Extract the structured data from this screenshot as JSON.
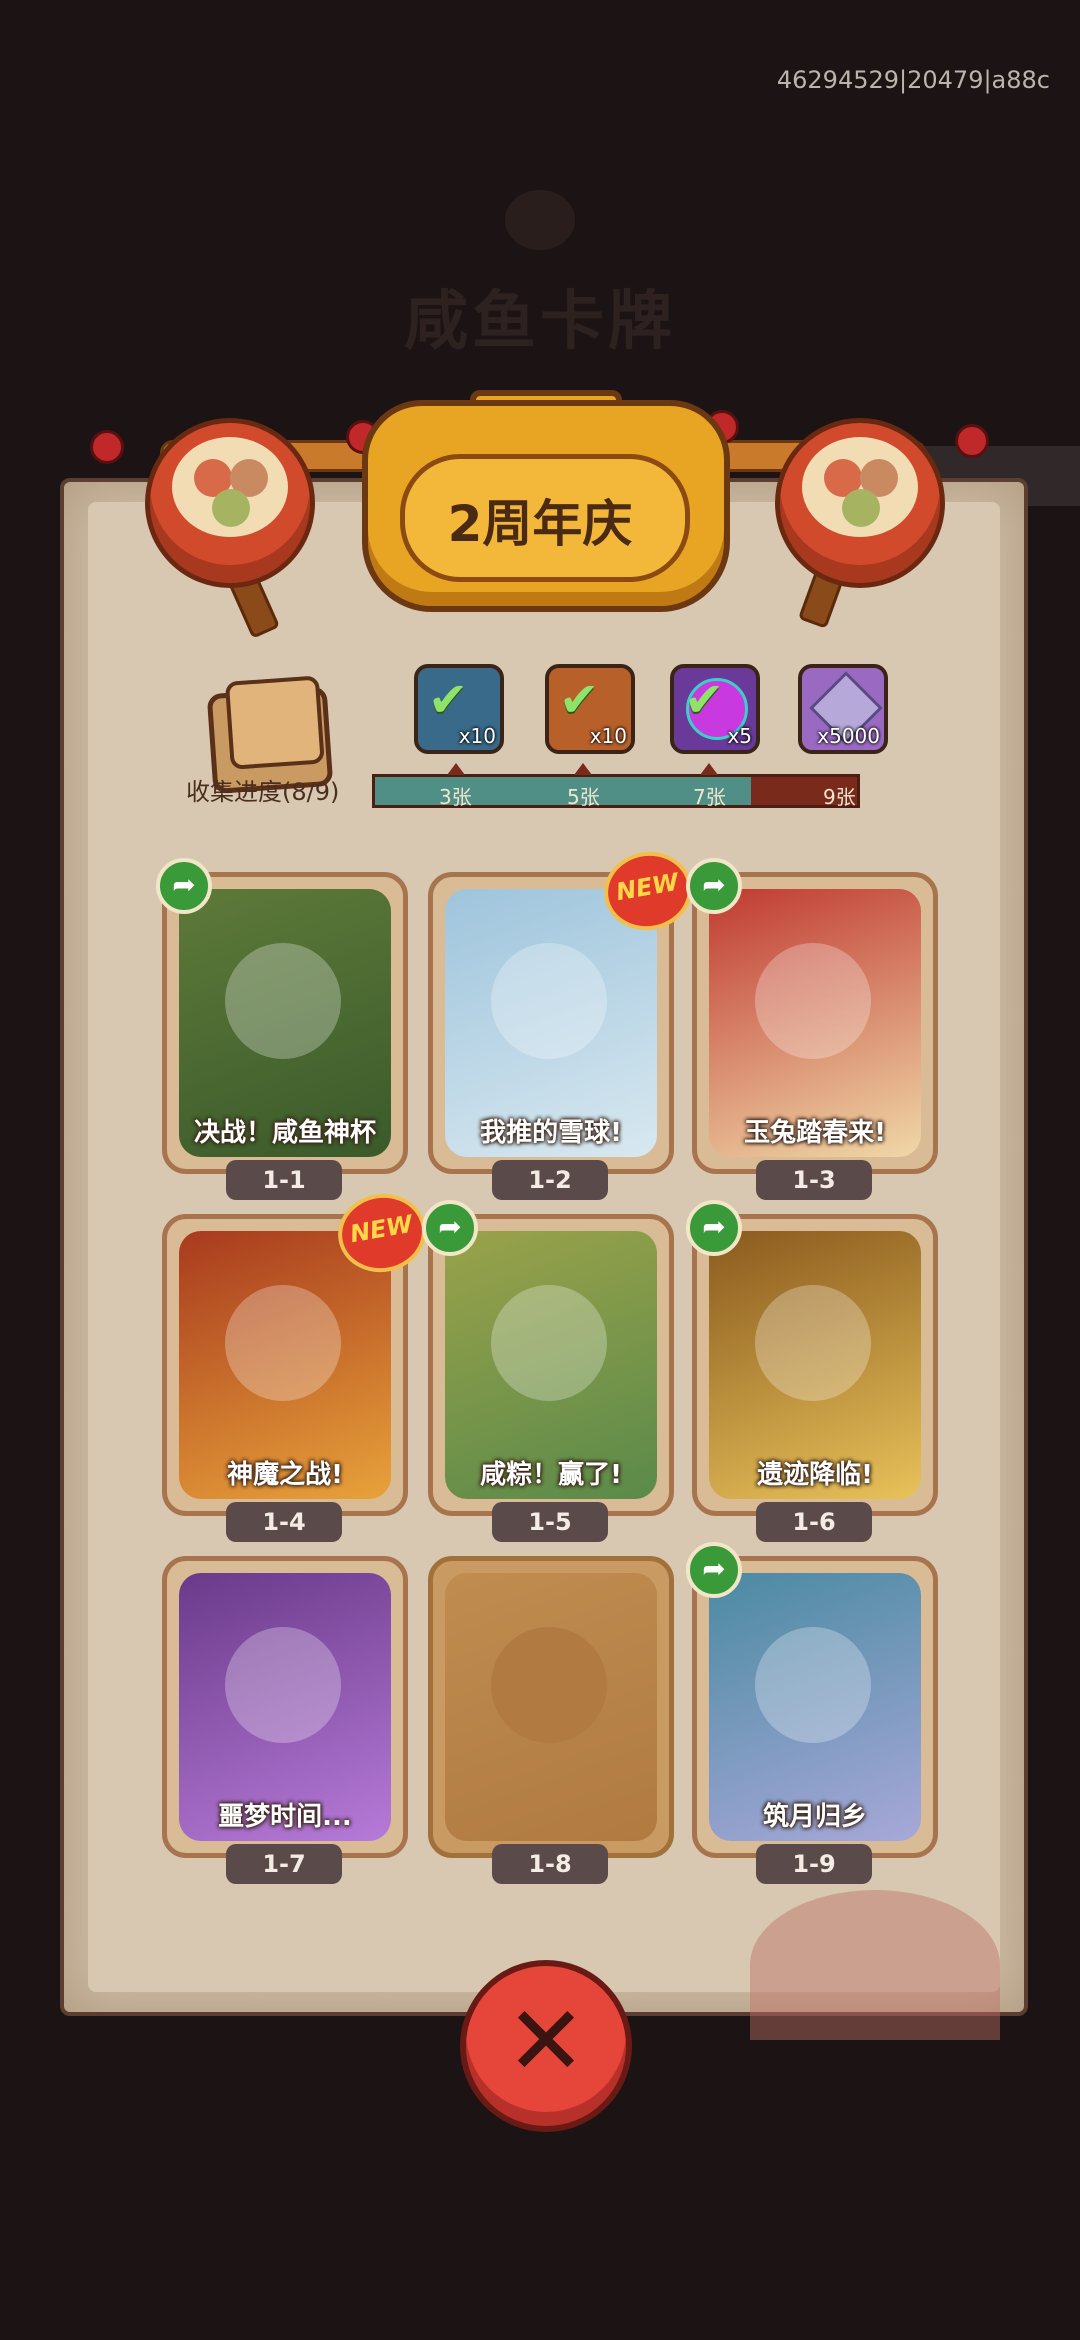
{
  "build_id": "46294529|20479|a88c",
  "background_title": "咸鱼卡牌",
  "event_title": "2周年庆",
  "collection": {
    "label": "收集进度(8/9)",
    "progress_fraction": 0.78,
    "milestones": [
      {
        "label": "3张",
        "reward_qty": "x10",
        "reward_icon": "treasure-chest-icon",
        "claimed": true
      },
      {
        "label": "5张",
        "reward_qty": "x10",
        "reward_icon": "scroll-bundle-icon",
        "claimed": true
      },
      {
        "label": "7张",
        "reward_qty": "x5",
        "reward_icon": "purple-orb-icon",
        "claimed": true
      },
      {
        "label": "9张",
        "reward_qty": "x5000",
        "reward_icon": "crystal-gem-icon",
        "claimed": false
      }
    ]
  },
  "cards": [
    {
      "id": "1-1",
      "title": "决战！咸鱼神杯",
      "share": true,
      "new": false,
      "locked": false,
      "color": "#5e7a3a",
      "color2": "#3a5a2a"
    },
    {
      "id": "1-2",
      "title": "我推的雪球!",
      "share": false,
      "new": true,
      "locked": false,
      "color": "#9ec4dc",
      "color2": "#d8e8f0"
    },
    {
      "id": "1-3",
      "title": "玉兔踏春来!",
      "share": true,
      "new": false,
      "locked": false,
      "color": "#c03a32",
      "color2": "#f0d8a8"
    },
    {
      "id": "1-4",
      "title": "神魔之战!",
      "share": false,
      "new": true,
      "locked": false,
      "color": "#a83a1e",
      "color2": "#e8a23a"
    },
    {
      "id": "1-5",
      "title": "咸粽！赢了!",
      "share": true,
      "new": false,
      "locked": false,
      "color": "#9aa24a",
      "color2": "#5a8a4a"
    },
    {
      "id": "1-6",
      "title": "遗迹降临!",
      "share": true,
      "new": false,
      "locked": false,
      "color": "#8a5a1e",
      "color2": "#e8c25a"
    },
    {
      "id": "1-7",
      "title": "噩梦时间...",
      "share": false,
      "new": false,
      "locked": false,
      "color": "#6a3a8a",
      "color2": "#b67ad8"
    },
    {
      "id": "1-8",
      "title": "",
      "share": false,
      "new": false,
      "locked": true,
      "color": "#c08c50",
      "color2": "#b07a40"
    },
    {
      "id": "1-9",
      "title": "筑月归乡",
      "share": true,
      "new": false,
      "locked": false,
      "color": "#4a8aa2",
      "color2": "#a8a8d8"
    }
  ],
  "new_badge_text": "NEW",
  "share_icon": "share-arrow-icon",
  "close_icon": "close-x-icon",
  "close_symbol": "✕",
  "share_symbol": "➦"
}
